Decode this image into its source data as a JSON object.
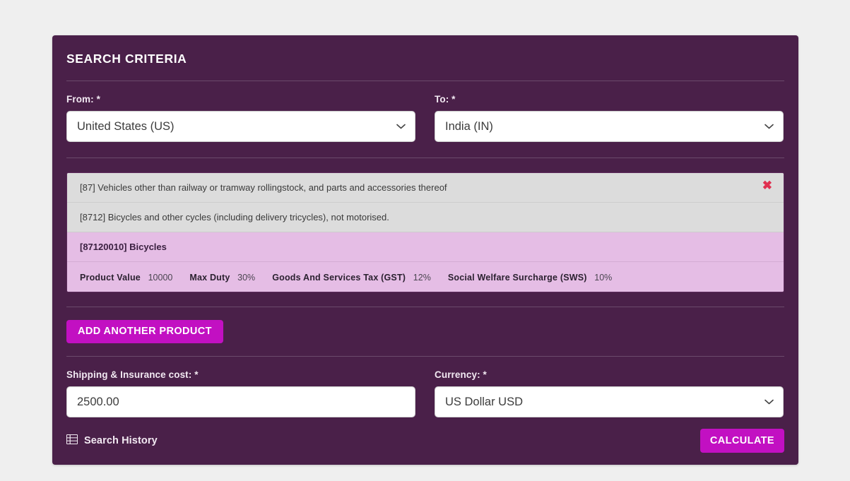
{
  "panel": {
    "title": "SEARCH CRITERIA"
  },
  "fields": {
    "from": {
      "label": "From: *",
      "value": "United States (US)",
      "icon": "chevron-down-icon"
    },
    "to": {
      "label": "To: *",
      "value": "India (IN)",
      "icon": "chevron-down-icon"
    },
    "shipping": {
      "label": "Shipping & Insurance cost: *",
      "value": "2500.00",
      "placeholder": "0.00"
    },
    "currency": {
      "label": "Currency: *",
      "value": "US Dollar USD",
      "icon": "chevron-down-icon"
    }
  },
  "product": {
    "chapter": "[87] Vehicles other than railway or tramway rollingstock, and parts and accessories thereof",
    "heading": "[8712] Bicycles and other cycles (including delivery tricycles), not motorised.",
    "item": "[87120010] Bicycles",
    "remove_icon": "close-icon",
    "remove_label": "✖",
    "details": [
      {
        "key": "Product Value",
        "value": "10000"
      },
      {
        "key": "Max Duty",
        "value": "30%"
      },
      {
        "key": "Goods And Services Tax (GST)",
        "value": "12%"
      },
      {
        "key": "Social Welfare Surcharge (SWS)",
        "value": "10%"
      }
    ]
  },
  "actions": {
    "add_product": "ADD ANOTHER PRODUCT",
    "calculate": "CALCULATE",
    "search_history": "Search History",
    "search_history_icon": "table-list-icon"
  },
  "colors": {
    "panel_bg": "#4a2049",
    "accent": "#c210c2",
    "row_gray": "#dcdcdc",
    "row_pink": "#e5bde5",
    "close_red": "#e03050",
    "page_bg": "#efefef"
  }
}
